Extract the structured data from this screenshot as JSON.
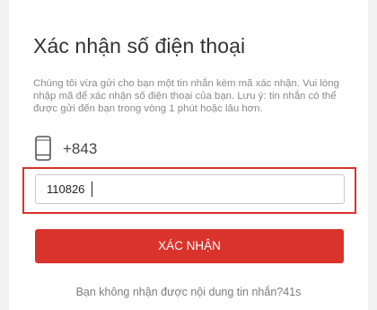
{
  "dialog": {
    "title": "Xác nhận số điện thoại",
    "description": "Chúng tôi vừa gửi cho bạn một tin nhắn kèm mã xác nhận. Vui lòng nhập mã để xác nhận số điện thoại của bạn. Lưu ý: tin nhắn có thể được gửi đến bạn trong vòng 1 phút hoặc lâu hơn.",
    "phone_number": "+843",
    "phone_icon": "mobile-phone-icon",
    "code_input_value": "110826",
    "confirm_label": "XÁC NHẬN",
    "resend_text": "Bạn không nhận được nội dung tin nhắn?",
    "countdown": "41s"
  },
  "colors": {
    "accent": "#d9332b",
    "highlight_border": "#d8332c"
  }
}
